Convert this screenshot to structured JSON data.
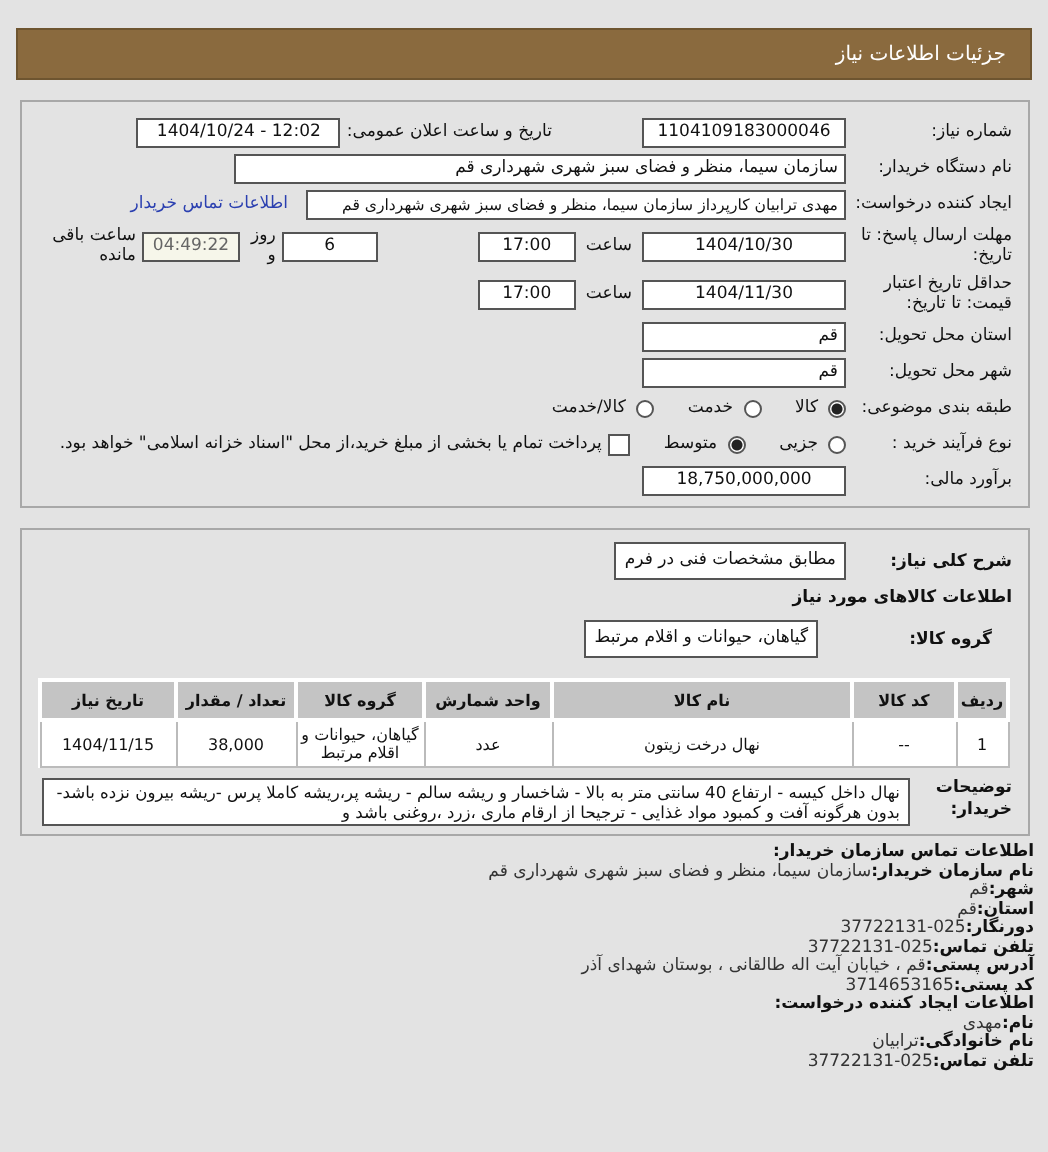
{
  "header": {
    "title": "جزئیات اطلاعات نیاز"
  },
  "need_number": {
    "label": "شماره نیاز:",
    "value": "1104109183000046"
  },
  "announce": {
    "label": "تاریخ و ساعت اعلان عمومی:",
    "value": "1404/10/24 - 12:02"
  },
  "buyer": {
    "label": "نام دستگاه خریدار:",
    "value": "سازمان سیما، منظر و فضای سبز شهری شهرداری قم"
  },
  "requester": {
    "label": "ایجاد کننده درخواست:",
    "value": "مهدی ترابیان کارپرداز سازمان سیما، منظر و فضای سبز شهری شهرداری قم",
    "link": "اطلاعات تماس خریدار"
  },
  "deadline": {
    "label": "مهلت ارسال پاسخ: تا تاریخ:",
    "date": "1404/10/30",
    "time_label": "ساعت",
    "time": "17:00",
    "days": "6",
    "days_label": "روز و",
    "remaining": "04:49:22",
    "remaining_label": "ساعت باقی مانده"
  },
  "validity": {
    "label": "حداقل تاریخ اعتبار قیمت: تا تاریخ:",
    "date": "1404/11/30",
    "time_label": "ساعت",
    "time": "17:00"
  },
  "province": {
    "label": "استان محل تحویل:",
    "value": "قم"
  },
  "city": {
    "label": "شهر محل تحویل:",
    "value": "قم"
  },
  "category": {
    "label": "طبقه بندی موضوعی:",
    "options": [
      {
        "label": "کالا",
        "selected": true
      },
      {
        "label": "خدمت",
        "selected": false
      },
      {
        "label": "کالا/خدمت",
        "selected": false
      }
    ]
  },
  "process": {
    "label": "نوع فرآیند خرید :",
    "options": [
      {
        "label": "جزیی",
        "selected": false
      },
      {
        "label": "متوسط",
        "selected": true
      }
    ],
    "treasury": {
      "label": "پرداخت تمام یا بخشی از مبلغ خرید،از محل \"اسناد خزانه اسلامی\" خواهد بود.",
      "checked": false
    }
  },
  "estimate": {
    "label": "برآورد مالی:",
    "value": "18,750,000,000"
  },
  "summary": {
    "label": "شرح کلی نیاز:",
    "value": "مطابق مشخصات فنی در فرم"
  },
  "goods_heading": "اطلاعات کالاهای مورد نیاز",
  "goods_group": {
    "label": "گروه کالا:",
    "value": "گیاهان، حیوانات و اقلام مرتبط"
  },
  "table": {
    "columns": [
      "ردیف",
      "کد کالا",
      "نام کالا",
      "واحد شمارش",
      "گروه کالا",
      "تعداد / مقدار",
      "تاریخ نیاز"
    ],
    "rows": [
      [
        "1",
        "--",
        "نهال درخت زیتون",
        "عدد",
        "گیاهان، حیوانات و اقلام مرتبط",
        "38,000",
        "1404/11/15"
      ]
    ]
  },
  "notes": {
    "label": "توضیحات خریدار:",
    "value": "نهال داخل کیسه - ارتفاع 40 سانتی متر به بالا - شاخسار و ریشه سالم - ریشه پر،ریشه کاملا پرس -ریشه بیرون نزده باشد- بدون هرگونه آفت و کمبود مواد غذایی - ترجیحا از ارقام ماری ،زرد ،روغنی باشد و"
  },
  "contact": {
    "heading": "اطلاعات تماس سازمان خریدار:",
    "lines": [
      {
        "label": "نام سازمان خریدار:",
        "value": "سازمان سیما، منظر و فضای سبز شهری شهرداری قم"
      },
      {
        "label": "شهر:",
        "value": "قم"
      },
      {
        "label": "استان:",
        "value": "قم"
      },
      {
        "label": "دورنگار:",
        "value": "025-37722131"
      },
      {
        "label": "تلفن تماس:",
        "value": "025-37722131"
      },
      {
        "label": "آدرس پستی:",
        "value": "قم ، خیابان آیت اله طالقانی ، بوستان شهدای آذر"
      },
      {
        "label": "کد پستی:",
        "value": "3714653165"
      }
    ]
  },
  "creator": {
    "heading": "اطلاعات ایجاد کننده درخواست:",
    "lines": [
      {
        "label": "نام:",
        "value": "مهدی"
      },
      {
        "label": "نام خانوادگی:",
        "value": "ترابیان"
      },
      {
        "label": "تلفن تماس:",
        "value": "025-37722131"
      }
    ]
  }
}
